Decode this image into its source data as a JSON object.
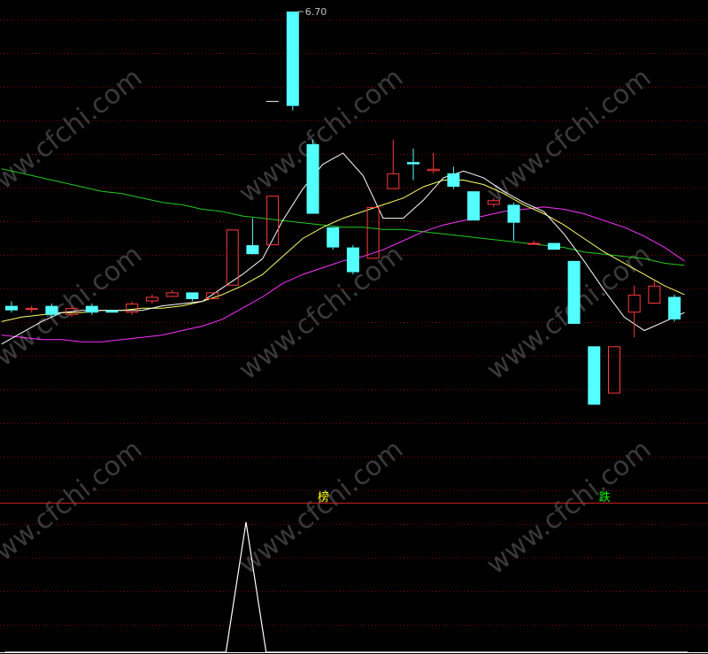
{
  "colors": {
    "background": "#000000",
    "grid": "#800000",
    "up": "#ff3b3b",
    "down": "#54ffff",
    "ma_short": "#ffffff",
    "ma_mid": "#ffff66",
    "ma_long": "#ff33ff",
    "ma_trend": "#22cc22",
    "divider": "#cc2222",
    "indicator": "#ffffff",
    "watermark": "#3a3a3a"
  },
  "watermark_text": "www.cfchi.com",
  "chart_data": [
    {
      "type": "candlestick",
      "title": "",
      "price_label": "6.70",
      "y_range_px_note": "",
      "candles": [
        {
          "o": 5.39,
          "h": 5.41,
          "l": 5.36,
          "c": 5.37
        },
        {
          "o": 5.38,
          "h": 5.39,
          "l": 5.36,
          "c": 5.38
        },
        {
          "o": 5.39,
          "h": 5.4,
          "l": 5.34,
          "c": 5.35
        },
        {
          "o": 5.35,
          "h": 5.39,
          "l": 5.34,
          "c": 5.38
        },
        {
          "o": 5.39,
          "h": 5.4,
          "l": 5.35,
          "c": 5.36
        },
        {
          "o": 5.37,
          "h": 5.37,
          "l": 5.36,
          "c": 5.36
        },
        {
          "o": 5.36,
          "h": 5.41,
          "l": 5.35,
          "c": 5.4
        },
        {
          "o": 5.41,
          "h": 5.44,
          "l": 5.4,
          "c": 5.43
        },
        {
          "o": 5.43,
          "h": 5.46,
          "l": 5.43,
          "c": 5.45
        },
        {
          "o": 5.45,
          "h": 5.45,
          "l": 5.41,
          "c": 5.42
        },
        {
          "o": 5.42,
          "h": 5.45,
          "l": 5.42,
          "c": 5.45
        },
        {
          "o": 5.48,
          "h": 5.73,
          "l": 5.48,
          "c": 5.73
        },
        {
          "o": 5.66,
          "h": 5.78,
          "l": 5.62,
          "c": 5.62
        },
        {
          "o": 5.66,
          "h": 5.88,
          "l": 5.66,
          "c": 5.88
        },
        {
          "o": 6.7,
          "h": 6.7,
          "l": 6.26,
          "c": 6.28
        },
        {
          "o": 6.11,
          "h": 6.13,
          "l": 5.8,
          "c": 5.8
        },
        {
          "o": 5.74,
          "h": 5.74,
          "l": 5.64,
          "c": 5.65
        },
        {
          "o": 5.65,
          "h": 5.66,
          "l": 5.53,
          "c": 5.54
        },
        {
          "o": 5.6,
          "h": 5.83,
          "l": 5.6,
          "c": 5.83
        },
        {
          "o": 5.91,
          "h": 6.13,
          "l": 5.91,
          "c": 5.98
        },
        {
          "o": 6.03,
          "h": 6.09,
          "l": 5.95,
          "c": 6.02
        },
        {
          "o": 5.99,
          "h": 6.07,
          "l": 5.98,
          "c": 6.0
        },
        {
          "o": 5.98,
          "h": 6.01,
          "l": 5.91,
          "c": 5.92
        },
        {
          "o": 5.9,
          "h": 5.9,
          "l": 5.77,
          "c": 5.77
        },
        {
          "o": 5.84,
          "h": 5.87,
          "l": 5.83,
          "c": 5.86
        },
        {
          "o": 5.84,
          "h": 5.85,
          "l": 5.68,
          "c": 5.76
        },
        {
          "o": 5.67,
          "h": 5.68,
          "l": 5.67,
          "c": 5.67
        },
        {
          "o": 5.67,
          "h": 5.67,
          "l": 5.64,
          "c": 5.64
        },
        {
          "o": 5.59,
          "h": 5.59,
          "l": 5.31,
          "c": 5.31
        },
        {
          "o": 5.21,
          "h": 5.21,
          "l": 4.95,
          "c": 4.95
        },
        {
          "o": 5.0,
          "h": 5.21,
          "l": 5.0,
          "c": 5.21
        },
        {
          "o": 5.36,
          "h": 5.48,
          "l": 5.25,
          "c": 5.44
        },
        {
          "o": 5.4,
          "h": 5.5,
          "l": 5.4,
          "c": 5.48
        },
        {
          "o": 5.43,
          "h": 5.44,
          "l": 5.32,
          "c": 5.33
        }
      ],
      "ma_short": [
        5.22,
        5.27,
        5.32,
        5.36,
        5.37,
        5.37,
        5.37,
        5.37,
        5.39,
        5.4,
        5.41,
        5.47,
        5.53,
        5.6,
        5.77,
        5.91,
        6.02,
        6.07,
        5.97,
        5.78,
        5.78,
        5.86,
        5.96,
        5.99,
        5.96,
        5.9,
        5.85,
        5.81,
        5.71,
        5.59,
        5.46,
        5.34,
        5.28,
        5.32,
        5.36
      ],
      "ma_mid": [
        5.32,
        5.34,
        5.35,
        5.36,
        5.36,
        5.37,
        5.37,
        5.38,
        5.38,
        5.39,
        5.41,
        5.44,
        5.48,
        5.53,
        5.61,
        5.69,
        5.74,
        5.78,
        5.81,
        5.84,
        5.87,
        5.92,
        5.95,
        5.95,
        5.93,
        5.89,
        5.84,
        5.8,
        5.75,
        5.69,
        5.63,
        5.58,
        5.53,
        5.48,
        5.44
      ],
      "ma_long": [
        5.26,
        5.25,
        5.24,
        5.24,
        5.23,
        5.23,
        5.24,
        5.25,
        5.26,
        5.28,
        5.3,
        5.33,
        5.38,
        5.43,
        5.49,
        5.53,
        5.56,
        5.59,
        5.61,
        5.64,
        5.68,
        5.72,
        5.75,
        5.77,
        5.79,
        5.81,
        5.82,
        5.83,
        5.82,
        5.8,
        5.77,
        5.74,
        5.7,
        5.65,
        5.59
      ],
      "ma_trend": [
        6.0,
        5.98,
        5.96,
        5.94,
        5.92,
        5.9,
        5.89,
        5.87,
        5.85,
        5.84,
        5.82,
        5.81,
        5.79,
        5.78,
        5.77,
        5.76,
        5.75,
        5.74,
        5.74,
        5.73,
        5.73,
        5.72,
        5.71,
        5.7,
        5.69,
        5.68,
        5.67,
        5.66,
        5.65,
        5.63,
        5.62,
        5.61,
        5.6,
        5.58,
        5.57
      ]
    },
    {
      "type": "line",
      "title": "",
      "signals": [
        {
          "index": 15.5,
          "text": "榜",
          "color": "#ffff00"
        },
        {
          "index": 29.5,
          "text": "跌",
          "color": "#00ff00"
        }
      ],
      "values": [
        0,
        0,
        0,
        0,
        0,
        0,
        0,
        0,
        0,
        0,
        0,
        0,
        1,
        0,
        0,
        0,
        0,
        0,
        0,
        0,
        0,
        0,
        0,
        0,
        0,
        0,
        0,
        0,
        0,
        0,
        0,
        0,
        0,
        0,
        0
      ]
    }
  ]
}
